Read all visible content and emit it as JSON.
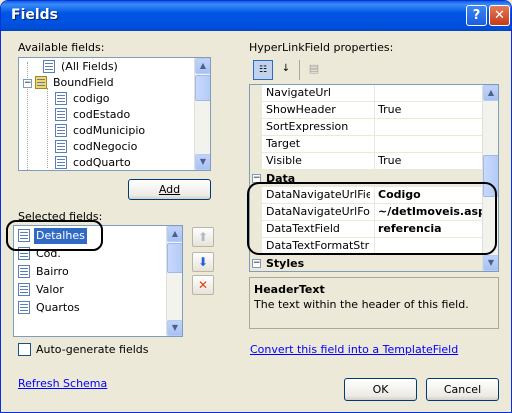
{
  "window": {
    "title": "Fields",
    "help_glyph": "?",
    "close_glyph": "✕"
  },
  "available": {
    "label": "Available fields:",
    "items": [
      "(All Fields)",
      "BoundField",
      "codigo",
      "codEstado",
      "codMunicipio",
      "codNegocio",
      "codQuarto"
    ],
    "add_label": "Add"
  },
  "selected": {
    "label": "Selected fields:",
    "items": [
      "Detalhes",
      "Cod.",
      "Bairro",
      "Valor",
      "Quartos"
    ]
  },
  "autogen": {
    "label": "Auto-generate fields"
  },
  "refresh": {
    "label": "Refresh Schema"
  },
  "props": {
    "label": "HyperLinkField properties:",
    "rows_top": [
      {
        "name": "NavigateUrl",
        "value": ""
      },
      {
        "name": "ShowHeader",
        "value": "True"
      },
      {
        "name": "SortExpression",
        "value": ""
      },
      {
        "name": "Target",
        "value": ""
      },
      {
        "name": "Visible",
        "value": "True"
      }
    ],
    "cat_data": "Data",
    "rows_data": [
      {
        "name": "DataNavigateUrlFiel",
        "value": "Codigo"
      },
      {
        "name": "DataNavigateUrlFor",
        "value": "~/detImoveis.aspx"
      },
      {
        "name": "DataTextField",
        "value": "referencia"
      },
      {
        "name": "DataTextFormatStri",
        "value": ""
      }
    ],
    "cat_styles": "Styles"
  },
  "description": {
    "title": "HeaderText",
    "text": "The text within the header of this field."
  },
  "convert": {
    "label": "Convert this field into a TemplateField"
  },
  "ok_label": "OK",
  "cancel_label": "Cancel"
}
